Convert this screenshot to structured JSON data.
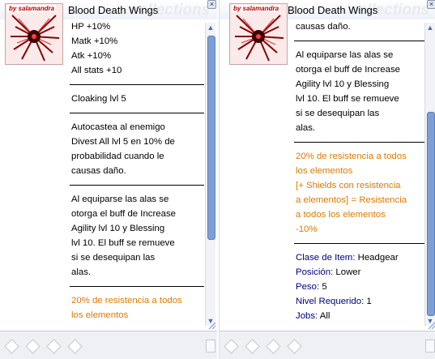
{
  "window_left": {
    "title": "Blood Death Wings",
    "watermark": "collections",
    "signature": "by salamandra",
    "stats": [
      "HP +10%",
      "Matk +10%",
      "Atk +10%",
      "All stats +10"
    ],
    "skill": "Cloaking lvl 5",
    "autocast": [
      "Autocastea al enemigo",
      "Divest All lvl 5 en 10% de",
      "probabilidad cuando le",
      "causas daño."
    ],
    "equip": [
      "Al equiparse las alas se",
      "otorga el buff de Increase",
      "Agility lvl 10 y Blessing",
      "lvl 10. El buff se remueve",
      "si se desequipan las",
      "alas."
    ],
    "resist": [
      "20% de resistencia a todos",
      "los elementos"
    ],
    "close_glyph": "×",
    "scroll_up": "▲",
    "scroll_down": "▼"
  },
  "window_right": {
    "title": "Blood Death Wings",
    "watermark": "collections",
    "signature": "by salamandra",
    "top_line": "causas daño.",
    "equip": [
      "Al equiparse las alas se",
      "otorga el buff de Increase",
      "Agility lvl 10 y Blessing",
      "lvl 10. El buff se remueve",
      "si se desequipan las",
      "alas."
    ],
    "resist": [
      "20% de resistencia a todos",
      "los elementos",
      "[+ Shields con resistencia",
      "a elementos] = Resistencia",
      "a todos los elementos",
      "-10%"
    ],
    "info": [
      {
        "label": "Clase de Item:",
        "value": "Headgear"
      },
      {
        "label": "Posición:",
        "value": "Lower"
      },
      {
        "label": "Peso:",
        "value": "5"
      },
      {
        "label": "Nivel Requerido:",
        "value": "1"
      },
      {
        "label": "Jobs:",
        "value": "All"
      }
    ],
    "close_glyph": "×",
    "scroll_up": "▲",
    "scroll_down": "▼"
  },
  "colors": {
    "accent_orange": "#dd7a00",
    "label_navy": "#000080",
    "scrollbar_blue": "#7e9fd5"
  },
  "icons": [
    "close-icon",
    "scroll-up-icon",
    "scroll-down-icon",
    "resize-grip-icon",
    "card-slot-icon",
    "item-wings-image"
  ]
}
